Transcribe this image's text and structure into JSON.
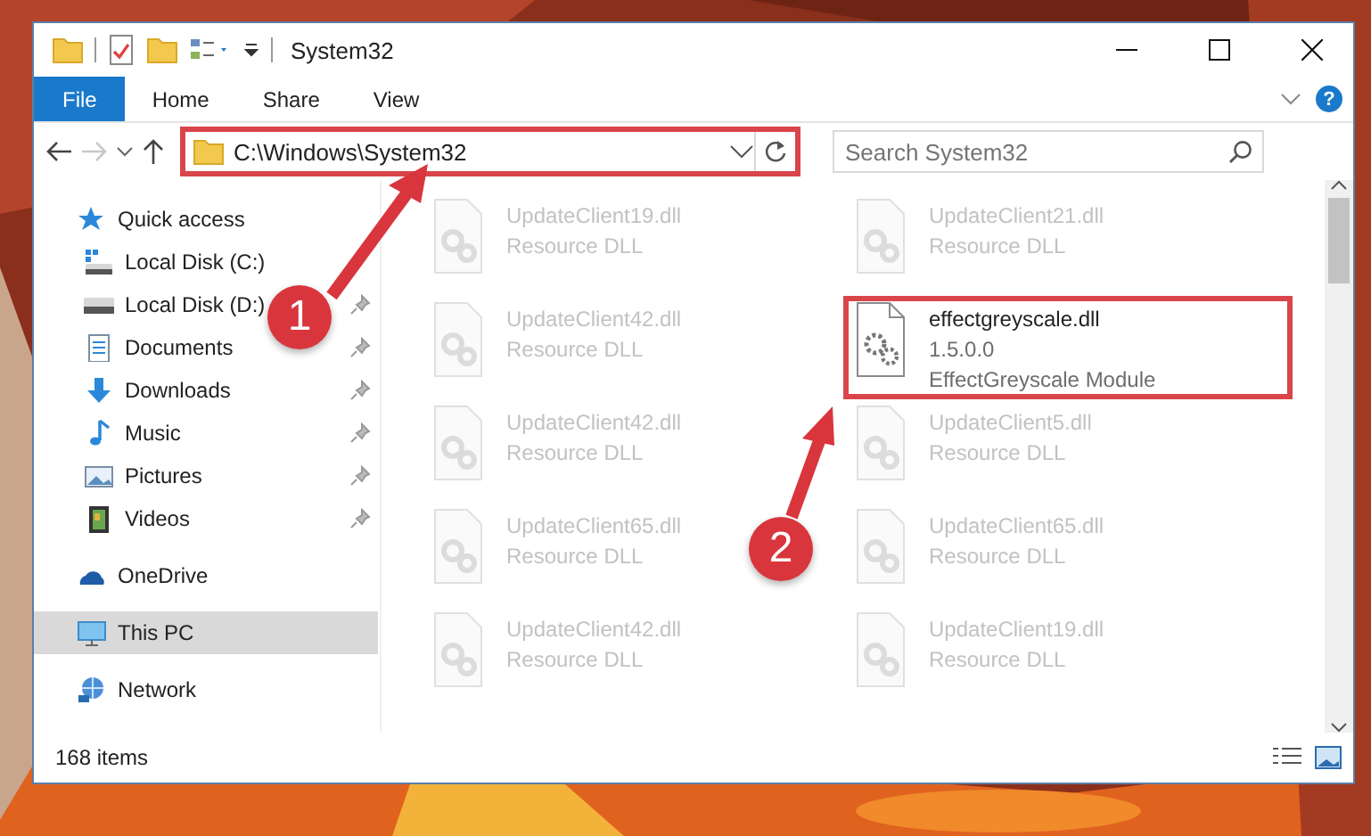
{
  "window": {
    "title": "System32"
  },
  "ribbon": {
    "tabs": [
      {
        "label": "File",
        "selected": true
      },
      {
        "label": "Home",
        "selected": false
      },
      {
        "label": "Share",
        "selected": false
      },
      {
        "label": "View",
        "selected": false
      }
    ],
    "help": "?"
  },
  "address_bar": {
    "path": "C:\\Windows\\System32",
    "highlighted": true
  },
  "search": {
    "placeholder": "Search System32"
  },
  "sidebar": {
    "items": [
      {
        "label": "Quick access",
        "kind": "quick",
        "selected": false,
        "children": [
          {
            "label": "Local Disk (C:)",
            "kind": "drive-c",
            "pinned": false,
            "selected": false
          },
          {
            "label": "Local Disk (D:)",
            "kind": "drive",
            "pinned": true,
            "selected": false
          },
          {
            "label": "Documents",
            "kind": "documents",
            "pinned": true,
            "selected": false
          },
          {
            "label": "Downloads",
            "kind": "downloads",
            "pinned": true,
            "selected": false
          },
          {
            "label": "Music",
            "kind": "music",
            "pinned": true,
            "selected": false
          },
          {
            "label": "Pictures",
            "kind": "pictures",
            "pinned": true,
            "selected": false
          },
          {
            "label": "Videos",
            "kind": "videos",
            "pinned": true,
            "selected": false
          }
        ]
      },
      {
        "label": "OneDrive",
        "kind": "cloud",
        "selected": false
      },
      {
        "label": "This PC",
        "kind": "pc",
        "selected": true
      },
      {
        "label": "Network",
        "kind": "network",
        "selected": false
      }
    ]
  },
  "files": [
    {
      "name": "UpdateClient19.dll",
      "lines": [
        "Resource DLL"
      ],
      "faded": true,
      "highlighted": false
    },
    {
      "name": "UpdateClient21.dll",
      "lines": [
        "Resource DLL"
      ],
      "faded": true,
      "highlighted": false
    },
    {
      "name": "UpdateClient42.dll",
      "lines": [
        "Resource DLL"
      ],
      "faded": true,
      "highlighted": false
    },
    {
      "name": "effectgreyscale.dll",
      "lines": [
        "1.5.0.0",
        "EffectGreyscale Module"
      ],
      "faded": false,
      "highlighted": true
    },
    {
      "name": "UpdateClient42.dll",
      "lines": [
        "Resource DLL"
      ],
      "faded": true,
      "highlighted": false
    },
    {
      "name": "UpdateClient5.dll",
      "lines": [
        "Resource DLL"
      ],
      "faded": true,
      "highlighted": false
    },
    {
      "name": "UpdateClient65.dll",
      "lines": [
        "Resource DLL"
      ],
      "faded": true,
      "highlighted": false
    },
    {
      "name": "UpdateClient65.dll",
      "lines": [
        "Resource DLL"
      ],
      "faded": true,
      "highlighted": false
    },
    {
      "name": "UpdateClient42.dll",
      "lines": [
        "Resource DLL"
      ],
      "faded": true,
      "highlighted": false
    },
    {
      "name": "UpdateClient19.dll",
      "lines": [
        "Resource DLL"
      ],
      "faded": true,
      "highlighted": false
    }
  ],
  "status_bar": {
    "count": "168 items"
  },
  "annotations": [
    {
      "number": "1"
    },
    {
      "number": "2"
    }
  ]
}
